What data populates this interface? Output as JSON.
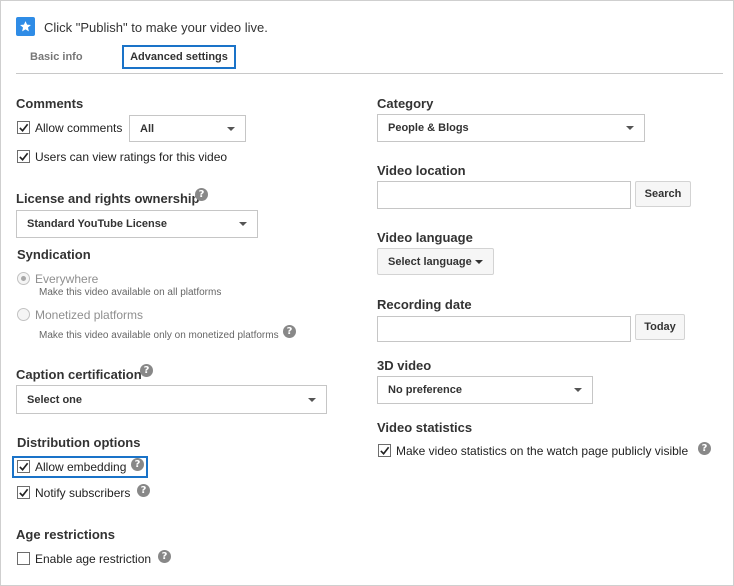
{
  "header": {
    "notice": "Click \"Publish\" to make your video live.",
    "icon": "star-icon",
    "accent": "#2f8ce6"
  },
  "tabs": [
    {
      "label": "Basic info",
      "active": false
    },
    {
      "label": "Advanced settings",
      "active": true
    }
  ],
  "comments": {
    "heading": "Comments",
    "allow_label": "Allow comments",
    "allow_checked": true,
    "select_value": "All",
    "ratings_label": "Users can view ratings for this video",
    "ratings_checked": true
  },
  "license": {
    "heading": "License and rights ownership",
    "select_value": "Standard YouTube License"
  },
  "syndication": {
    "heading": "Syndication",
    "options": [
      {
        "label": "Everywhere",
        "sub": "Make this video available on all platforms",
        "selected": true
      },
      {
        "label": "Monetized platforms",
        "sub": "Make this video available only on monetized platforms",
        "selected": false
      }
    ]
  },
  "caption": {
    "heading": "Caption certification",
    "select_value": "Select one"
  },
  "distribution": {
    "heading": "Distribution options",
    "embedding_label": "Allow embedding",
    "embedding_checked": true,
    "notify_label": "Notify subscribers",
    "notify_checked": true
  },
  "age": {
    "heading": "Age restrictions",
    "label": "Enable age restriction",
    "checked": false
  },
  "category": {
    "heading": "Category",
    "select_value": "People & Blogs"
  },
  "location": {
    "heading": "Video location",
    "value": "",
    "button": "Search"
  },
  "language": {
    "heading": "Video language",
    "button": "Select language"
  },
  "recording": {
    "heading": "Recording date",
    "value": "",
    "button": "Today"
  },
  "video3d": {
    "heading": "3D video",
    "select_value": "No preference"
  },
  "statistics": {
    "heading": "Video statistics",
    "label": "Make video statistics on the watch page publicly visible",
    "checked": true
  }
}
